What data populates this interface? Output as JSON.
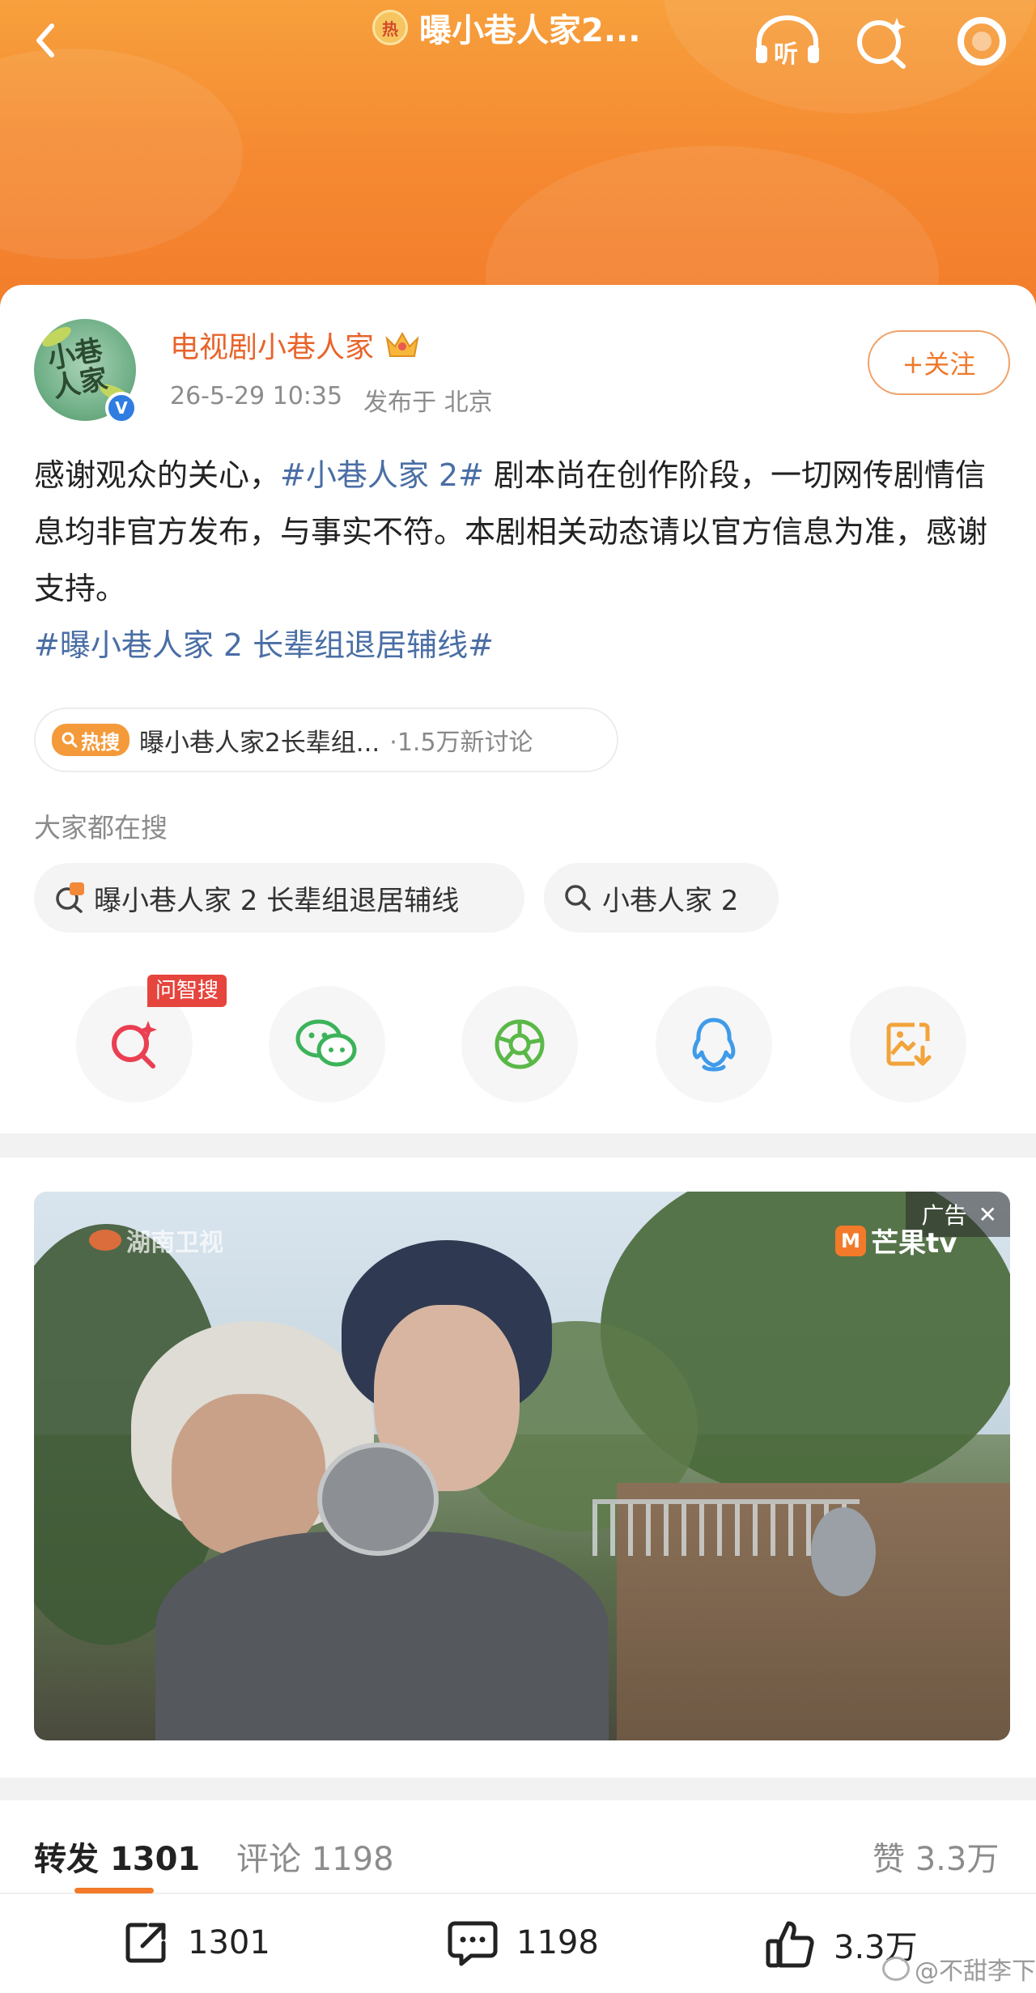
{
  "header": {
    "title": "曝小巷人家2...",
    "hot_badge": "热",
    "icons": [
      "back-icon",
      "listen-icon",
      "search-star-icon",
      "more-circle-icon"
    ],
    "listen_label": "听"
  },
  "post": {
    "author": "电视剧小巷人家",
    "timestamp": "26-5-29 10:35",
    "location": "发布于 北京",
    "follow_label": "+关注",
    "text_part1": "感谢观众的关心，",
    "tag1": "#小巷人家 2#",
    "text_part2": " 剧本尚在创作阶段，一切网传剧情信息均非官方发布，与事实不符。本剧相关动态请以官方信息为准，感谢支持。",
    "tag2": "#曝小巷人家 2 长辈组退居辅线#"
  },
  "hot_search": {
    "badge": "热搜",
    "topic": "曝小巷人家2长辈组...",
    "count": "·1.5万新讨论"
  },
  "related": {
    "label": "大家都在搜",
    "chips": [
      {
        "text": "曝小巷人家 2 长辈组退居辅线",
        "icon": "hot-search-icon"
      },
      {
        "text": "小巷人家 2",
        "icon": "search-icon"
      }
    ]
  },
  "share": {
    "ai_tag": "问智搜",
    "buttons": [
      "ai-search-icon",
      "wechat-icon",
      "moments-icon",
      "qq-icon",
      "save-image-icon"
    ]
  },
  "ad": {
    "label": "广告",
    "close": "✕",
    "watermark_left": "湖南卫视",
    "watermark_right": "芒果tv"
  },
  "stats": {
    "repost_label": "转发",
    "repost_count": "1301",
    "comment_label": "评论",
    "comment_count": "1198",
    "like_label": "赞",
    "like_count": "3.3万"
  },
  "actions": {
    "repost": "1301",
    "comment": "1198",
    "like": "3.3万"
  },
  "watermark": "@不甜李下",
  "colors": {
    "brand_orange": "#f27a2a",
    "author_orange": "#e8642b",
    "tag_blue": "#4a6ea5",
    "verify_blue": "#2f7de1"
  }
}
